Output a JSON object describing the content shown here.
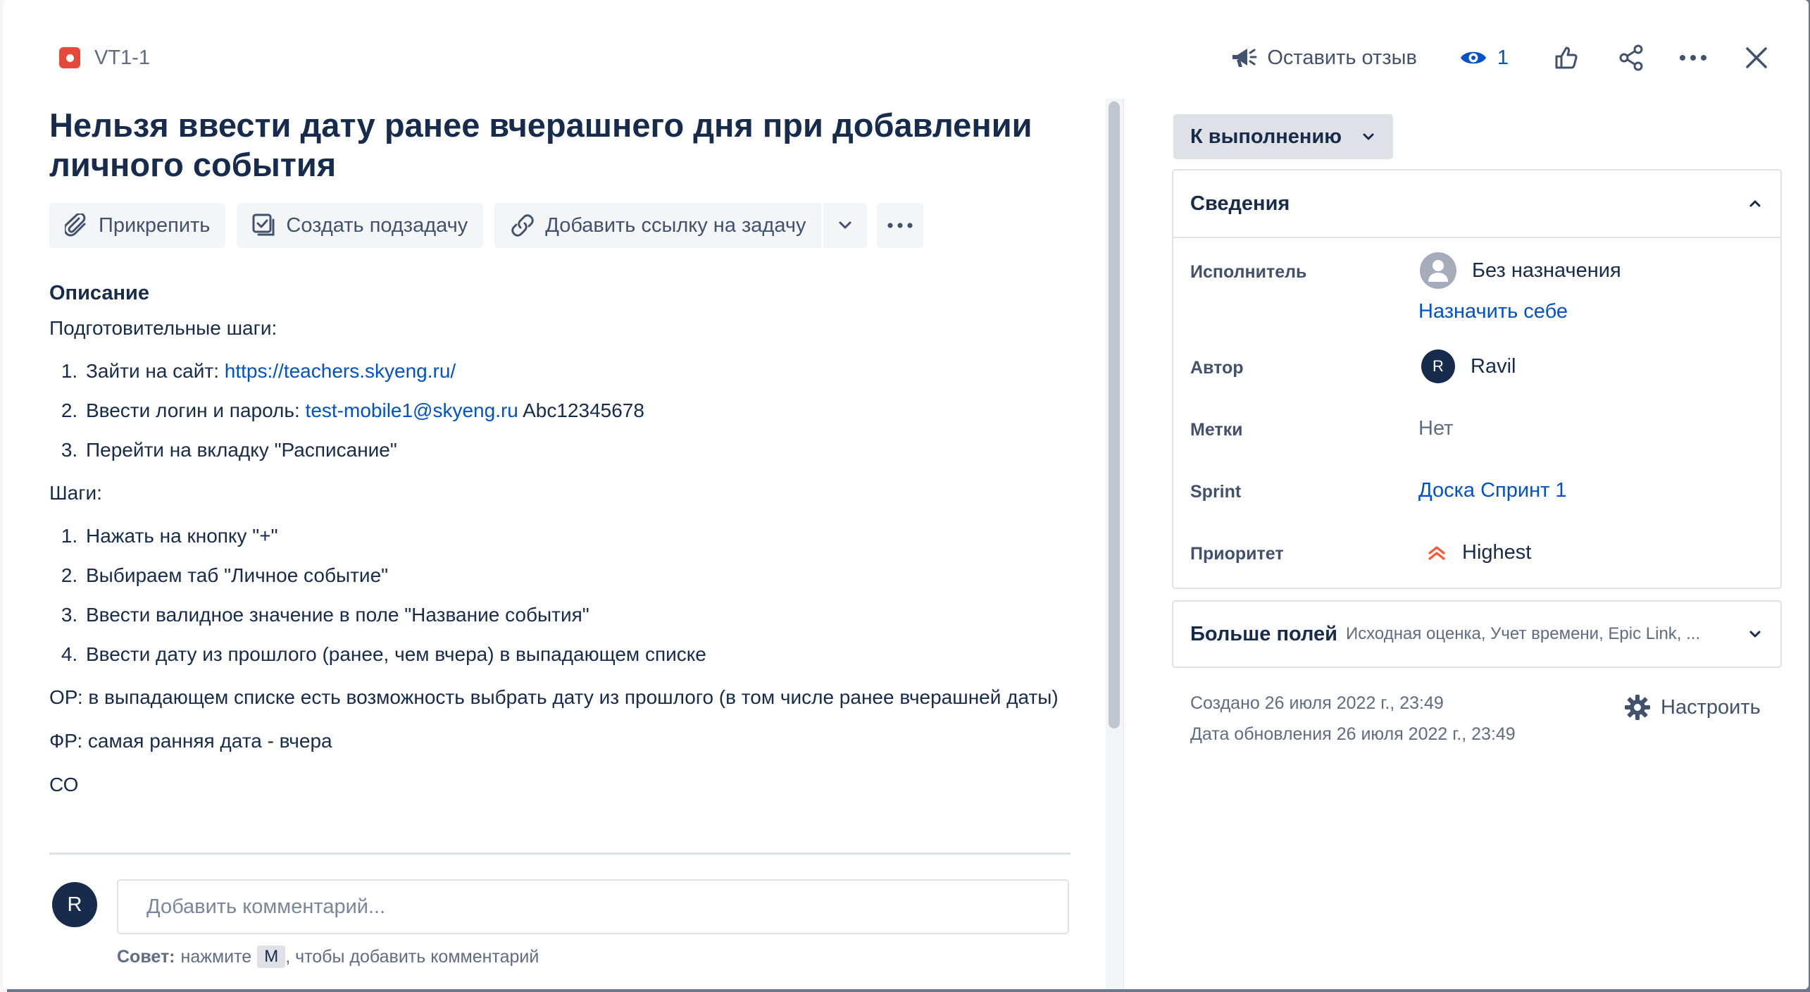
{
  "header": {
    "issue_key": "VT1-1",
    "feedback_label": "Оставить отзыв",
    "watchers_count": "1"
  },
  "issue": {
    "title": "Нельзя ввести дату ранее вчерашнего дня при добавлении личного события"
  },
  "toolbar": {
    "attach_label": "Прикрепить",
    "create_subtask_label": "Создать подзадачу",
    "add_link_label": "Добавить ссылку на задачу"
  },
  "description": {
    "heading": "Описание",
    "prep_label": "Подготовительные шаги:",
    "prep_steps": [
      {
        "text": "Зайти на сайт: ",
        "link": "https://teachers.skyeng.ru/"
      },
      {
        "text": "Ввести логин и пароль: ",
        "link": "test-mobile1@skyeng.ru",
        "suffix": " Abc12345678"
      },
      {
        "text": "Перейти на вкладку \"Расписание\""
      }
    ],
    "steps_label": "Шаги:",
    "steps": [
      "Нажать на кнопку \"+\"",
      "Выбираем таб \"Личное событие\"",
      "Ввести валидное значение в поле \"Название события\"",
      "Ввести дату из прошлого (ранее, чем вчера) в выпадающем списке"
    ],
    "expected": "ОР: в выпадающем списке есть возможность выбрать дату из прошлого (в том числе ранее вчерашней даты)",
    "actual": "ФР: самая ранняя дата - вчера",
    "cut_off_text": "СО"
  },
  "comment": {
    "avatar_initial": "R",
    "placeholder": "Добавить комментарий...",
    "tip_bold": "Совет:",
    "tip_before": "нажмите",
    "tip_key": "M",
    "tip_after": ", чтобы добавить комментарий"
  },
  "sidebar": {
    "status_label": "К выполнению",
    "details_title": "Сведения",
    "fields": {
      "assignee_label": "Исполнитель",
      "assignee_value": "Без назначения",
      "assign_to_me": "Назначить себе",
      "reporter_label": "Автор",
      "reporter_initial": "R",
      "reporter_value": "Ravil",
      "labels_label": "Метки",
      "labels_value": "Нет",
      "sprint_label": "Sprint",
      "sprint_value": "Доска Спринт 1",
      "priority_label": "Приоритет",
      "priority_value": "Highest"
    },
    "more_fields_title": "Больше полей",
    "more_fields_subtitle": "Исходная оценка, Учет времени, Epic Link, ...",
    "created": "Создано 26 июля 2022 г., 23:49",
    "updated": "Дата обновления 26 июля 2022 г., 23:49",
    "configure_label": "Настроить"
  },
  "colors": {
    "text_primary": "#172B4D",
    "link": "#0052CC",
    "bug": "#E5493A",
    "priority_highest": "#FF5630",
    "button_bg": "#F4F5F7"
  },
  "icons": [
    "bug-icon",
    "megaphone-icon",
    "eye-icon",
    "thumbs-up-icon",
    "share-icon",
    "more-icon",
    "close-icon",
    "paperclip-icon",
    "subtask-icon",
    "link-icon",
    "chevron-down-icon",
    "chevron-up-icon",
    "user-icon",
    "priority-highest-icon",
    "gear-icon"
  ]
}
